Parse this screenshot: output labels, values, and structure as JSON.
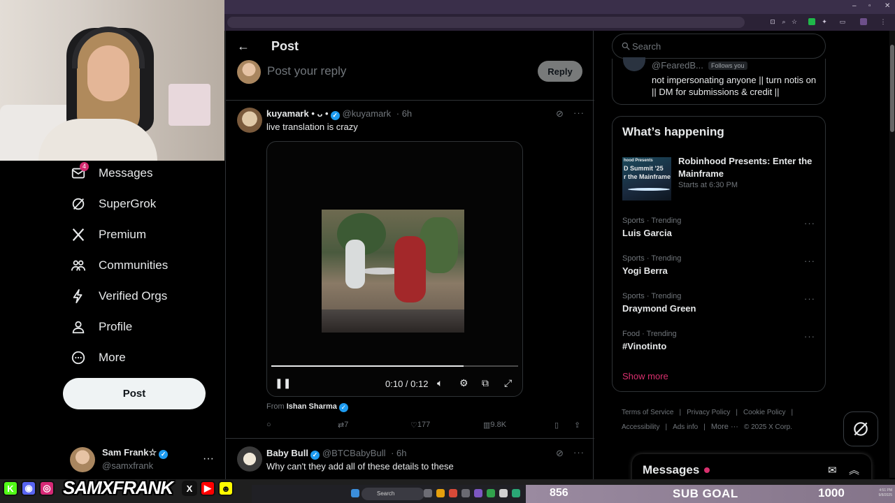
{
  "stream": {
    "brand": "SAMXFRANK",
    "socials": [
      {
        "icon": "kick-icon",
        "glyph": "K",
        "color": "#53fc18"
      },
      {
        "icon": "discord-icon",
        "glyph": "◉",
        "color": "#5865f2"
      },
      {
        "icon": "instagram-icon",
        "glyph": "◎",
        "color": "#d62976"
      },
      {
        "icon": "x-icon",
        "glyph": "X",
        "color": "#111111"
      },
      {
        "icon": "youtube-icon",
        "glyph": "▶",
        "color": "#ff0000"
      },
      {
        "icon": "snapchat-icon",
        "glyph": "☻",
        "color": "#fffc00"
      }
    ],
    "sub_goal": {
      "label": "SUB GOAL",
      "current": "856",
      "target": "1000"
    },
    "taskbar_search": "Search"
  },
  "nav": {
    "items": [
      {
        "label": "Messages",
        "icon": "mail-icon",
        "badge": "4"
      },
      {
        "label": "SuperGrok",
        "icon": "grok-icon"
      },
      {
        "label": "Premium",
        "icon": "x-logo-icon"
      },
      {
        "label": "Communities",
        "icon": "people-icon"
      },
      {
        "label": "Verified Orgs",
        "icon": "lightning-icon"
      },
      {
        "label": "Profile",
        "icon": "person-icon"
      },
      {
        "label": "More",
        "icon": "more-circle-icon"
      }
    ],
    "post_label": "Post",
    "account": {
      "name": "Sam Frank☆",
      "handle": "@samxfrank",
      "more": "···"
    }
  },
  "center": {
    "title": "Post",
    "reply_placeholder": "Post your reply",
    "reply_button": "Reply",
    "tweet": {
      "name": "kuyamark • ᴗ •",
      "handle": "@kuyamark",
      "time": "· 6h",
      "text": "live translation is crazy",
      "video": {
        "time": "0:10 / 0:12",
        "progress": 0.78
      },
      "from_label": "From",
      "from_name": "Ishan Sharma",
      "replies": "",
      "reposts": "7",
      "likes": "177",
      "views": "9.8K"
    },
    "tweet2": {
      "name": "Baby Bull",
      "handle": "@BTCBabyBull",
      "time": "· 6h",
      "text": "Why can't they add all of these details to these"
    }
  },
  "right": {
    "search_placeholder": "Search",
    "follow_card": {
      "handle": "@FearedB...",
      "follows_you": "Follows you",
      "bio": "not impersonating anyone || turn notis on || DM for submissions & credit ||"
    },
    "happening": {
      "title": "What’s happening",
      "promo": {
        "title": "Robinhood Presents: Enter the Mainframe",
        "sub": "Starts at 6:30 PM",
        "img_lines": [
          "hood Presents",
          "D Summit '25",
          "r the Mainframe"
        ]
      },
      "trends": [
        {
          "category": "Sports · Trending",
          "name": "Luis Garcia"
        },
        {
          "category": "Sports · Trending",
          "name": "Yogi Berra"
        },
        {
          "category": "Sports · Trending",
          "name": "Draymond Green"
        },
        {
          "category": "Food · Trending",
          "name": "#Vinotinto"
        }
      ],
      "show_more": "Show more"
    },
    "footer": {
      "links": [
        "Terms of Service",
        "|",
        "Privacy Policy",
        "|",
        "Cookie Policy",
        "|",
        "Accessibility",
        "|",
        "Ads info",
        "|",
        "More ···",
        "© 2025 X Corp."
      ]
    },
    "messages_drawer": "Messages"
  },
  "clock": {
    "time": "4:51 PM",
    "date": "9/8/2025"
  }
}
